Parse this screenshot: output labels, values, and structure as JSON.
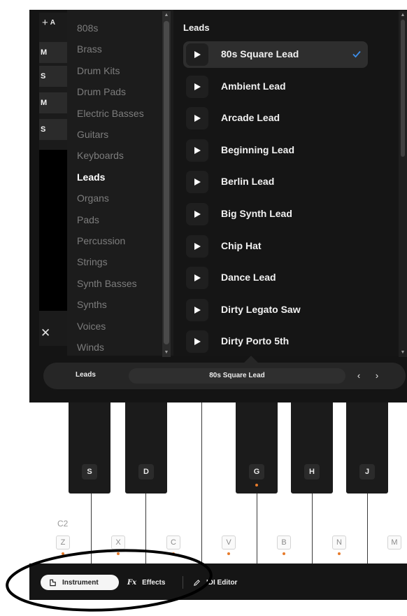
{
  "track_strip": {
    "add_label": "A",
    "tags": [
      "M",
      "S",
      "M",
      "S"
    ]
  },
  "categories": [
    {
      "label": "808s",
      "active": false
    },
    {
      "label": "Brass",
      "active": false
    },
    {
      "label": "Drum Kits",
      "active": false
    },
    {
      "label": "Drum Pads",
      "active": false
    },
    {
      "label": "Electric Basses",
      "active": false
    },
    {
      "label": "Guitars",
      "active": false
    },
    {
      "label": "Keyboards",
      "active": false
    },
    {
      "label": "Leads",
      "active": true
    },
    {
      "label": "Organs",
      "active": false
    },
    {
      "label": "Pads",
      "active": false
    },
    {
      "label": "Percussion",
      "active": false
    },
    {
      "label": "Strings",
      "active": false
    },
    {
      "label": "Synth Basses",
      "active": false
    },
    {
      "label": "Synths",
      "active": false
    },
    {
      "label": "Voices",
      "active": false
    },
    {
      "label": "Winds",
      "active": false
    }
  ],
  "preset_list": {
    "header": "Leads",
    "items": [
      {
        "label": "80s Square Lead",
        "selected": true
      },
      {
        "label": "Ambient Lead",
        "selected": false
      },
      {
        "label": "Arcade Lead",
        "selected": false
      },
      {
        "label": "Beginning Lead",
        "selected": false
      },
      {
        "label": "Berlin Lead",
        "selected": false
      },
      {
        "label": "Big Synth Lead",
        "selected": false
      },
      {
        "label": "Chip Hat",
        "selected": false
      },
      {
        "label": "Dance Lead",
        "selected": false
      },
      {
        "label": "Dirty Legato Saw",
        "selected": false
      },
      {
        "label": "Dirty Porto 5th",
        "selected": false
      }
    ]
  },
  "preset_bar": {
    "category": "Leads",
    "preset": "80s Square Lead",
    "prev_symbol": "‹",
    "next_symbol": "›"
  },
  "keyboard": {
    "octave_label": "C2",
    "black_keys": [
      {
        "label": "S",
        "dot": false
      },
      {
        "label": "D",
        "dot": false
      },
      {
        "label": "G",
        "dot": true
      },
      {
        "label": "H",
        "dot": false
      },
      {
        "label": "J",
        "dot": false
      }
    ],
    "white_keys": [
      "Z",
      "X",
      "C",
      "V",
      "B",
      "N",
      "M"
    ]
  },
  "bottom_bar": {
    "instrument_label": "Instrument",
    "effects_prefix": "Fx",
    "effects_label": "Effects",
    "midi_label": "IDI Editor"
  },
  "colors": {
    "accent_check": "#3d8eea",
    "key_dot": "#e77b2b",
    "annotation": "#000000"
  }
}
